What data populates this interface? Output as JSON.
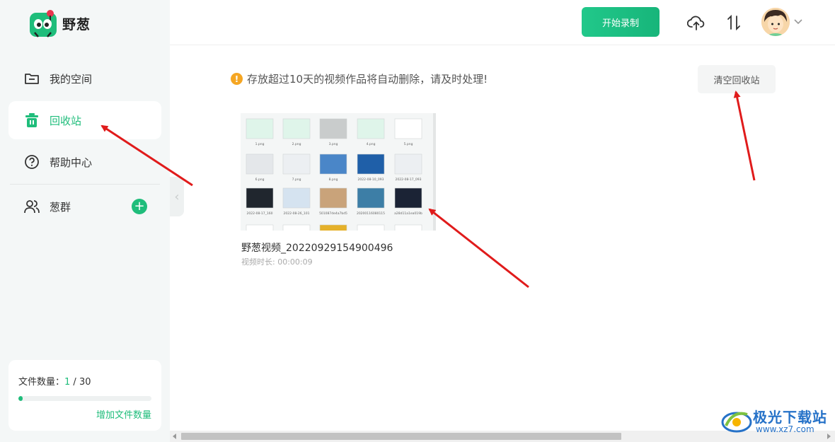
{
  "app": {
    "name": "野葱"
  },
  "sidebar": {
    "items": [
      {
        "label": "我的空间",
        "icon": "folder-icon"
      },
      {
        "label": "回收站",
        "icon": "trash-icon",
        "active": true
      },
      {
        "label": "帮助中心",
        "icon": "help-circle-icon"
      },
      {
        "label": "葱群",
        "icon": "group-icon"
      }
    ],
    "add_group_symbol": "+",
    "quota": {
      "label": "文件数量：",
      "current": "1",
      "separator": " / ",
      "max": "30",
      "fill_fraction": 0.033,
      "more_label": "增加文件数量"
    }
  },
  "header": {
    "record_label": "开始录制",
    "icons": [
      "upload-cloud-icon",
      "sort-icon",
      "avatar",
      "chevron-down-icon"
    ]
  },
  "main": {
    "notice": "存放超过10天的视频作品将自动删除，请及时处理!",
    "clear_label": "清空回收站",
    "video": {
      "title": "野葱视频_20220929154900496",
      "duration": "视频时长: 00:00:09",
      "thumb_files": [
        [
          "1.png",
          "2.png",
          "3.png",
          "4.png",
          "5.png"
        ],
        [
          "6.png",
          "7.png",
          "8.png",
          "2022-08-10_093443.png",
          "2022-08-17_093059.png"
        ],
        [
          "2022-08-17_160233.png",
          "2022-08-26_10165C.png",
          "501087de4a7bd579fa5a0c0818b34093.jpg",
          "20200116080115616T.jpg",
          "a28d11a1ea019bc84f1809910cdc175.jpeg"
        ]
      ]
    }
  },
  "watermark": {
    "text": "极光下载站",
    "url": "www.xz7.com"
  },
  "colors": {
    "accent": "#1fbd7b",
    "warning": "#f5a623",
    "annotation": "#e01b1b",
    "watermark": "#2672c8"
  }
}
